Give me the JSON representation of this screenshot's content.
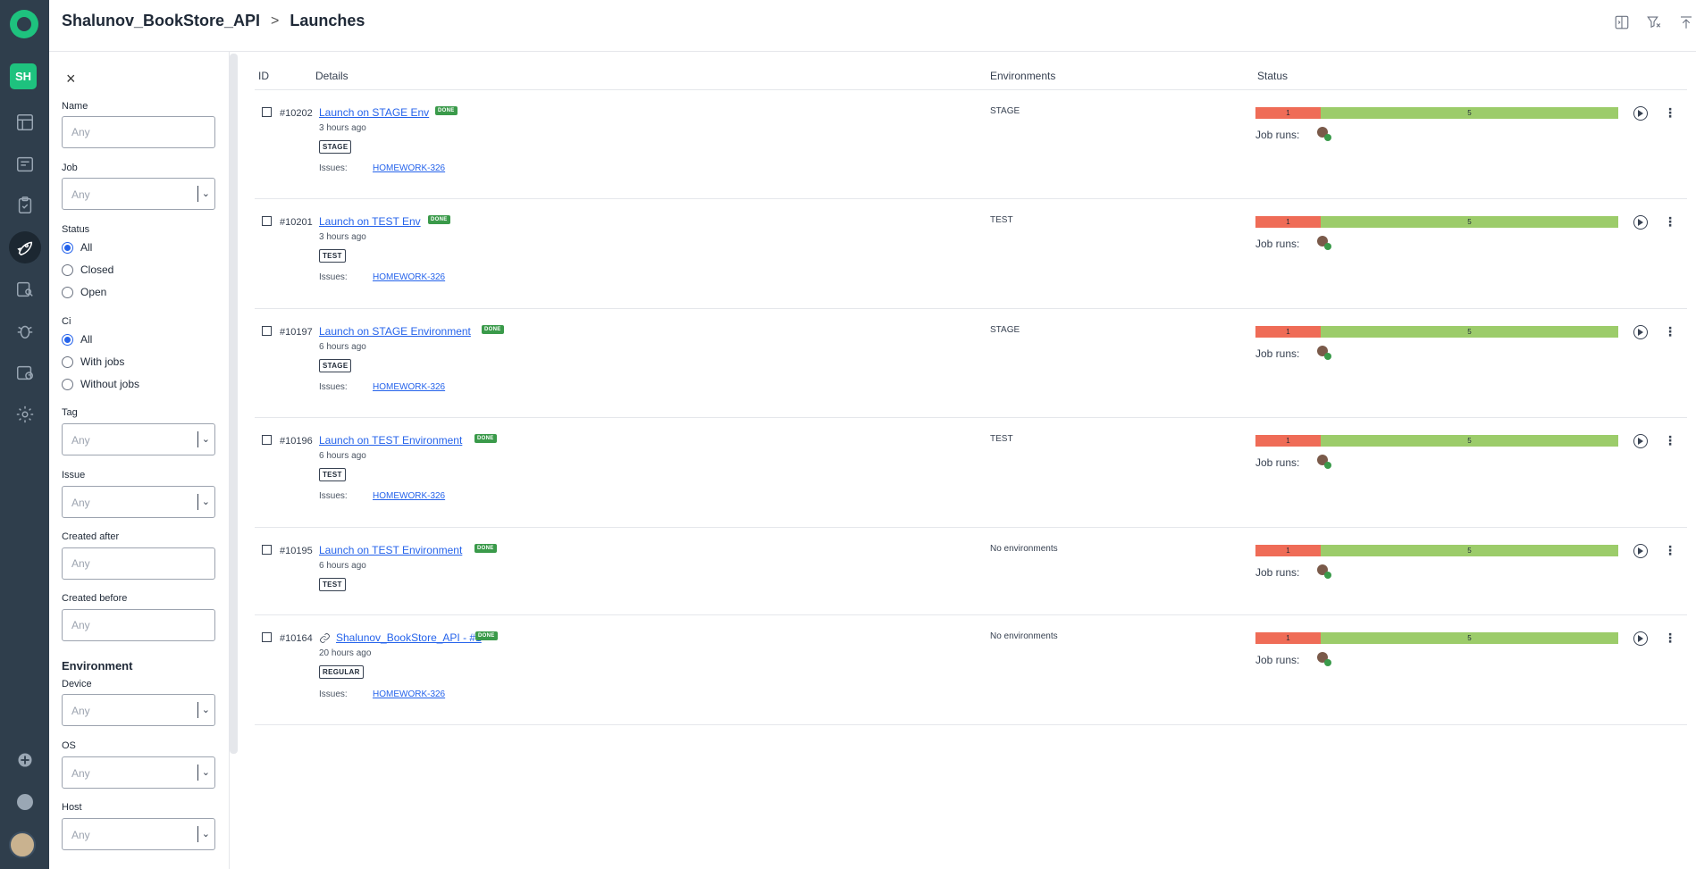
{
  "rail": {
    "project_initials": "SH",
    "nav": [
      "dashboard-icon",
      "test-runs-icon",
      "test-cases-icon",
      "launches-icon",
      "analytics-icon",
      "bugs-icon",
      "plans-icon",
      "settings-icon"
    ]
  },
  "header": {
    "project": "Shalunov_BookStore_API",
    "separator": ">",
    "page": "Launches"
  },
  "filters": {
    "close": "×",
    "name_label": "Name",
    "name_placeholder": "Any",
    "job_label": "Job",
    "job_value": "Any",
    "status_label": "Status",
    "status_options": [
      "All",
      "Closed",
      "Open"
    ],
    "status_selected": "All",
    "ci_label": "Ci",
    "ci_options": [
      "All",
      "With jobs",
      "Without jobs"
    ],
    "ci_selected": "All",
    "tag_label": "Tag",
    "tag_value": "Any",
    "issue_label": "Issue",
    "issue_value": "Any",
    "created_after_label": "Created after",
    "created_after_placeholder": "Any",
    "created_before_label": "Created before",
    "created_before_placeholder": "Any",
    "environment_title": "Environment",
    "device_label": "Device",
    "device_value": "Any",
    "os_label": "OS",
    "os_value": "Any",
    "host_label": "Host",
    "host_value": "Any"
  },
  "table": {
    "columns": [
      "ID",
      "Details",
      "Environments",
      "Status"
    ],
    "issues_label": "Issues:",
    "job_runs_label": "Job runs:",
    "done_badge": "DONE",
    "rows": [
      {
        "id": "#10202",
        "name": "Launch on STAGE Env",
        "time": "3 hours ago",
        "tag": "STAGE",
        "issue": "HOMEWORK-326",
        "env": "STAGE",
        "failed": "1",
        "passed": "5",
        "fail_fraction": 0.18
      },
      {
        "id": "#10201",
        "name": "Launch on TEST Env",
        "time": "3 hours ago",
        "tag": "TEST",
        "issue": "HOMEWORK-326",
        "env": "TEST",
        "failed": "1",
        "passed": "5",
        "fail_fraction": 0.18
      },
      {
        "id": "#10197",
        "name": "Launch on STAGE Environment",
        "time": "6 hours ago",
        "tag": "STAGE",
        "issue": "HOMEWORK-326",
        "env": "STAGE",
        "failed": "1",
        "passed": "5",
        "fail_fraction": 0.18
      },
      {
        "id": "#10196",
        "name": "Launch on TEST Environment",
        "time": "6 hours ago",
        "tag": "TEST",
        "issue": "HOMEWORK-326",
        "env": "TEST",
        "failed": "1",
        "passed": "5",
        "fail_fraction": 0.18
      },
      {
        "id": "#10195",
        "name": "Launch on TEST Environment",
        "time": "6 hours ago",
        "tag": "TEST",
        "issue": "",
        "env": "No environments",
        "failed": "1",
        "passed": "5",
        "fail_fraction": 0.18
      },
      {
        "id": "#10164",
        "name": "Shalunov_BookStore_API - #1",
        "time": "20 hours ago",
        "tag": "REGULAR",
        "issue": "HOMEWORK-326",
        "env": "No environments",
        "failed": "1",
        "passed": "5",
        "fail_fraction": 0.18,
        "linked": true
      }
    ]
  }
}
